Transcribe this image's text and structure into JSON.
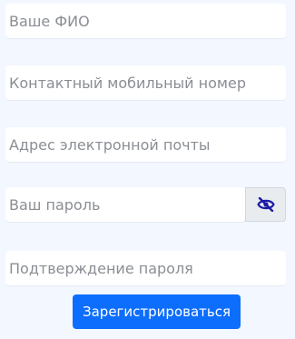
{
  "form": {
    "full_name": {
      "placeholder": "Ваше ФИО",
      "value": ""
    },
    "phone": {
      "placeholder": "Контактный мобильный номер",
      "value": ""
    },
    "email": {
      "placeholder": "Адрес электронной почты",
      "value": ""
    },
    "password": {
      "placeholder": "Ваш пароль",
      "value": ""
    },
    "password_confirm": {
      "placeholder": "Подтверждение пароля",
      "value": ""
    },
    "toggle_icon": "eye-slash-icon",
    "submit_label": "Зарегистрироваться"
  },
  "colors": {
    "background": "#f3f7ff",
    "field_bg": "#ffffff",
    "accent": "#0d6efd",
    "icon": "#1a1aa6"
  }
}
